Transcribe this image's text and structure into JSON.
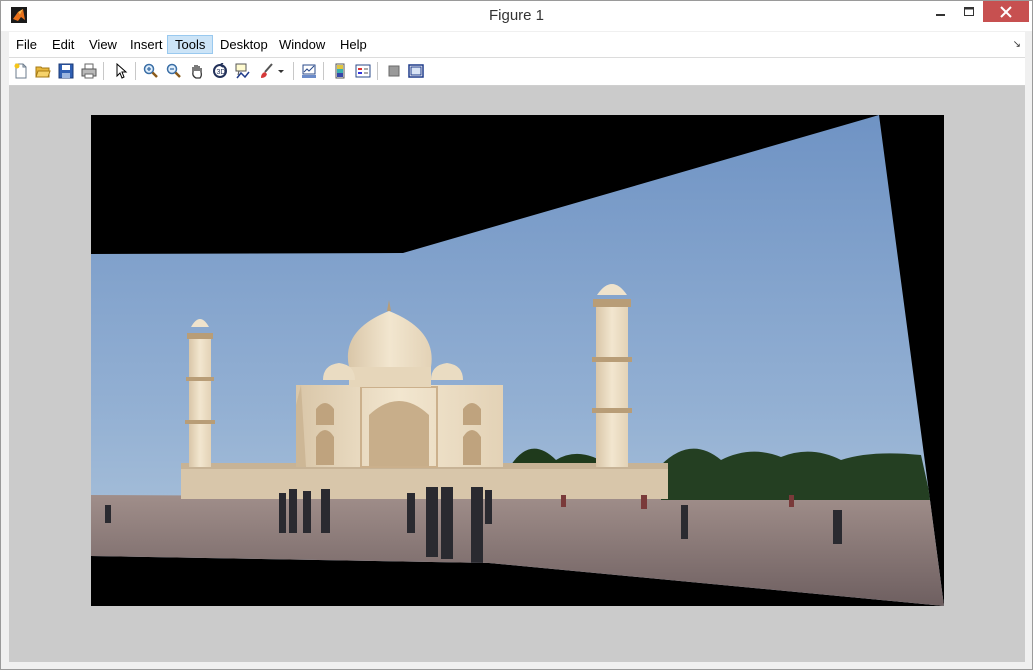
{
  "window": {
    "title": "Figure 1",
    "controls": {
      "minimize": "minimize",
      "maximize": "maximize",
      "close": "close"
    }
  },
  "menu": {
    "items": [
      {
        "label": "File"
      },
      {
        "label": "Edit"
      },
      {
        "label": "View"
      },
      {
        "label": "Insert"
      },
      {
        "label": "Tools",
        "active": true
      },
      {
        "label": "Desktop"
      },
      {
        "label": "Window"
      },
      {
        "label": "Help"
      }
    ],
    "dock_arrow": "↘"
  },
  "toolbar": {
    "tools": [
      "new-figure-icon",
      "open-file-icon",
      "save-figure-icon",
      "print-figure-icon",
      "edit-plot-icon",
      "zoom-in-icon",
      "zoom-out-icon",
      "pan-icon",
      "rotate-3d-icon",
      "data-cursor-icon",
      "brush-icon",
      "link-plot-icon",
      "insert-colorbar-icon",
      "insert-legend-icon",
      "hide-plot-tools-icon",
      "show-plot-tools-icon"
    ]
  },
  "figure": {
    "image_subject": "panorama of Taj Mahal with visitors",
    "colors": {
      "sky_top": "#6f93c4",
      "sky_bottom": "#b3c9dd",
      "marble": "#efe3cc",
      "ground": "#8a7878"
    }
  }
}
